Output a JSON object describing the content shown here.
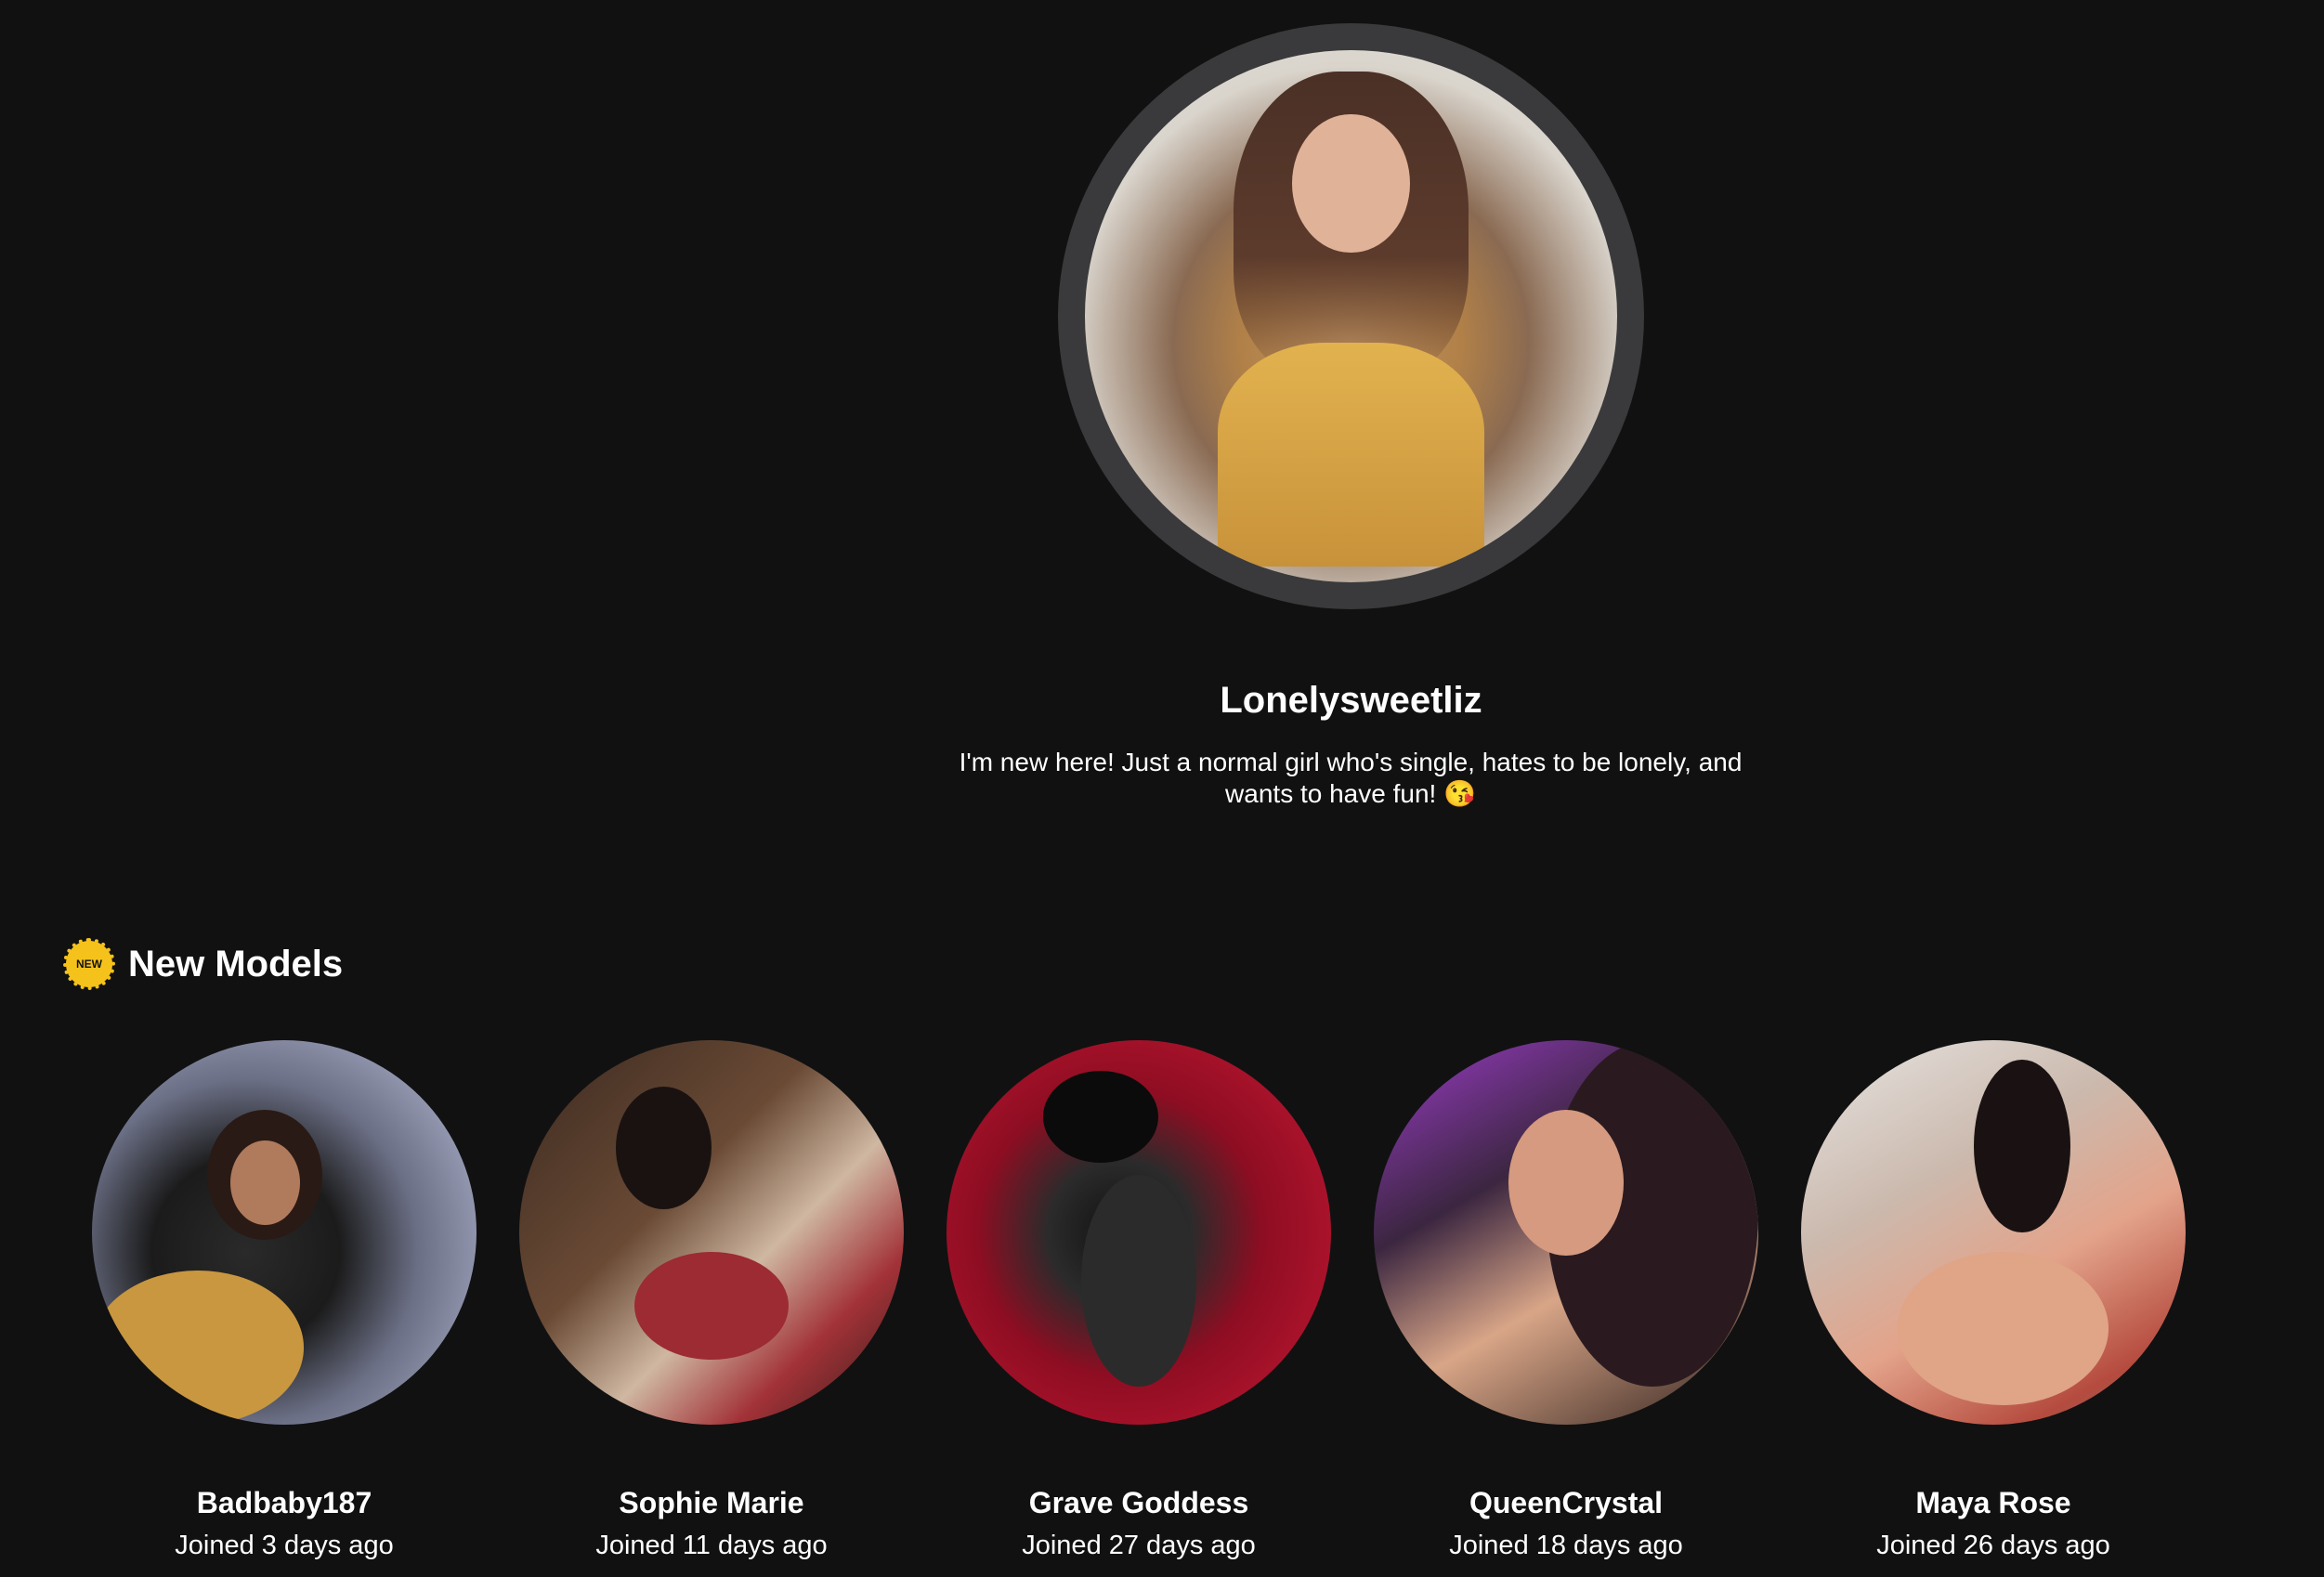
{
  "featured": {
    "name": "Lonelysweetliz",
    "bio": "I'm new here! Just a normal girl who's single, hates to be lonely, and wants to have fun! 😘"
  },
  "section": {
    "badge_text": "NEW",
    "badge_icon": "new-badge-icon",
    "title": "New Models"
  },
  "models": [
    {
      "name": "Badbaby187",
      "joined": "Joined 3 days ago"
    },
    {
      "name": "Sophie Marie",
      "joined": "Joined 11 days ago"
    },
    {
      "name": "Grave Goddess",
      "joined": "Joined 27 days ago"
    },
    {
      "name": "QueenCrystal",
      "joined": "Joined 18 days ago"
    },
    {
      "name": "Maya Rose",
      "joined": "Joined 26 days ago"
    }
  ],
  "colors": {
    "background": "#111112",
    "avatar_ring": "#3a3a3c",
    "badge": "#f5c21b",
    "text": "#ffffff"
  }
}
